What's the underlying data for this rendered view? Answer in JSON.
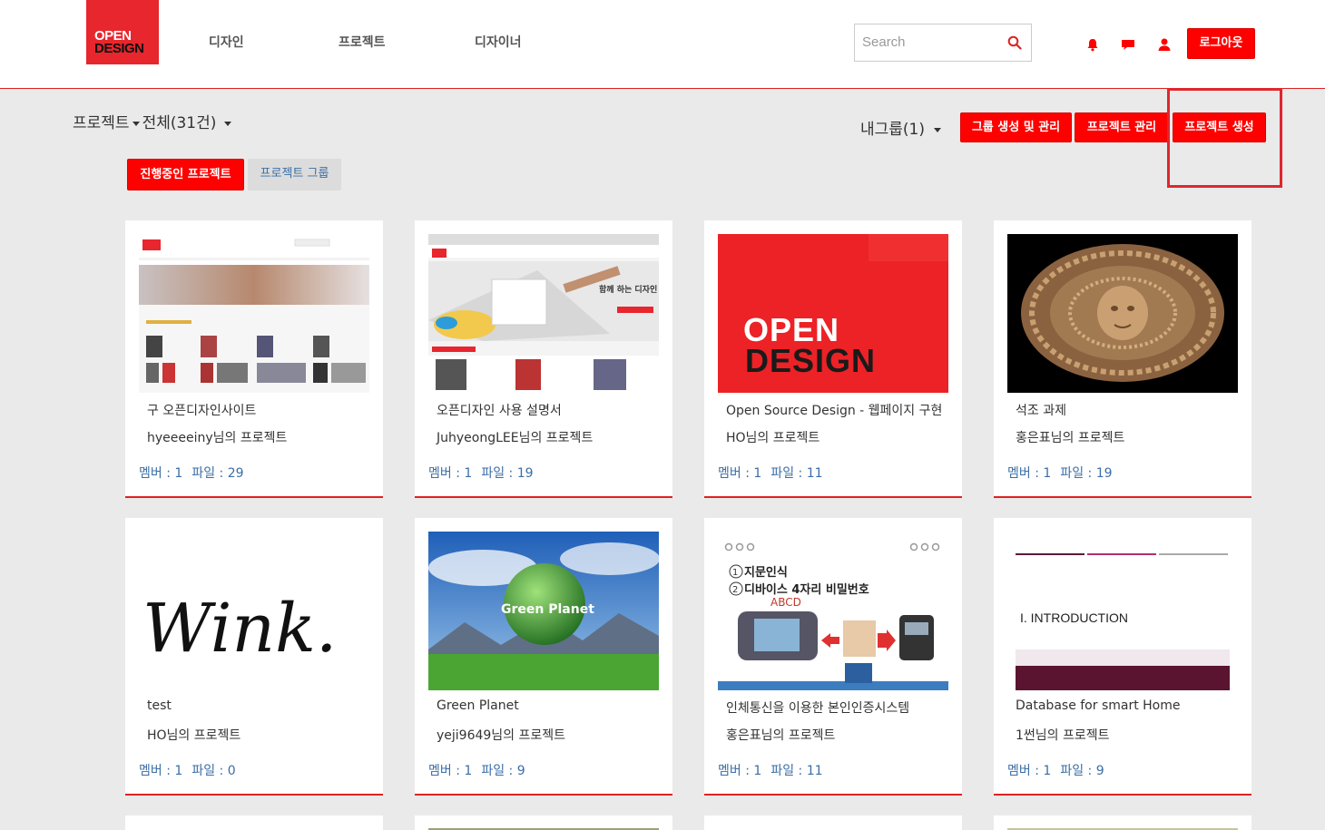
{
  "brand": {
    "line1": "OPEN",
    "line2": "DESIGN",
    "accent": "#e8262d"
  },
  "nav": [
    {
      "label": "디자인"
    },
    {
      "label": "프로젝트"
    },
    {
      "label": "디자이너"
    }
  ],
  "search": {
    "placeholder": "Search",
    "value": ""
  },
  "header_icons": [
    "bell-icon",
    "chat-icon",
    "user-icon"
  ],
  "logout_label": "로그아웃",
  "breadcrumb": {
    "section": "프로젝트",
    "filter": "전체(31건)"
  },
  "mygroup": {
    "label": "내그룹(1)"
  },
  "actions": {
    "group_manage": "그룹 생성 및 관리",
    "project_manage": "프로젝트 관리",
    "project_create": "프로젝트 생성"
  },
  "tabs": [
    {
      "label": "진행중인 프로젝트",
      "active": true
    },
    {
      "label": "프로젝트 그룹",
      "active": false
    }
  ],
  "stats_labels": {
    "member": "멤버 : ",
    "file": "파일 : "
  },
  "projects": [
    {
      "title": "구 오픈디자인사이트",
      "owner": "hyeeeeiny님의 프로젝트",
      "members": "1",
      "files": "29",
      "thumb": "old-site-screenshot"
    },
    {
      "title": "오픈디자인 사용 설명서",
      "owner": "JuhyeongLEE님의 프로젝트",
      "members": "1",
      "files": "19",
      "thumb": "manual-screenshot",
      "thumb_text": "함께 하는 디자인"
    },
    {
      "title": "Open Source Design - 웹페이지 구현",
      "owner": "HO님의 프로젝트",
      "members": "1",
      "files": "11",
      "thumb": "open-design-logo",
      "thumb_text_1": "OPEN",
      "thumb_text_2": "DESIGN"
    },
    {
      "title": "석조 과제",
      "owner": "홍은표님의 프로젝트",
      "members": "1",
      "files": "19",
      "thumb": "medusa-medallion"
    },
    {
      "title": "test",
      "owner": "HO님의 프로젝트",
      "members": "1",
      "files": "0",
      "thumb": "wink-script",
      "thumb_text": "Wink."
    },
    {
      "title": "Green Planet",
      "owner": "yeji9649님의 프로젝트",
      "members": "1",
      "files": "9",
      "thumb": "green-planet-landscape",
      "thumb_text": "Green Planet"
    },
    {
      "title": "인체통신을 이용한 본인인증시스템",
      "owner": "홍은표님의 프로젝트",
      "members": "1",
      "files": "11",
      "thumb": "fingerprint-slide",
      "thumb_line1": "지문인식",
      "thumb_line2": "디바이스 4자리 비밀번호",
      "thumb_line3": "ABCD"
    },
    {
      "title": "Database for smart Home",
      "owner": "1썬님의 프로젝트",
      "members": "1",
      "files": "9",
      "thumb": "introduction-slide",
      "thumb_text": "I. INTRODUCTION"
    }
  ]
}
